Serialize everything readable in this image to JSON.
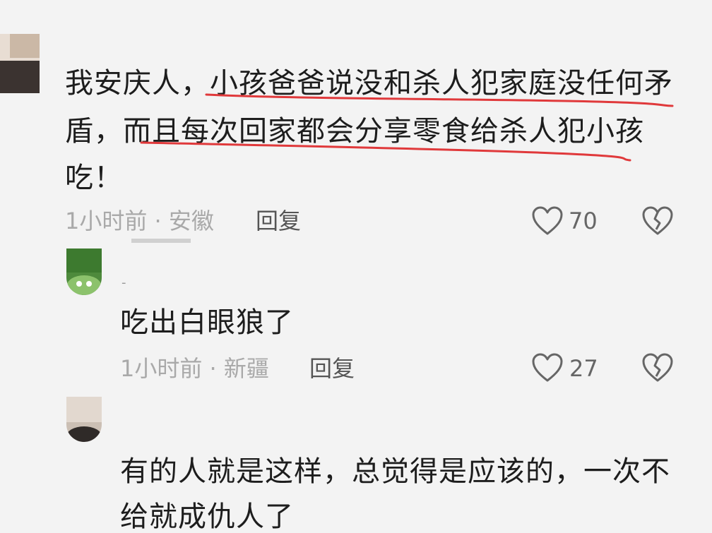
{
  "comments": [
    {
      "text_lines": [
        "我安庆人，小孩爸爸说没和杀人犯家庭没任何矛",
        "盾，而且每次回家都会分享零食给杀人犯小孩",
        "吃！"
      ],
      "meta": "1小时前 · 安徽",
      "reply_label": "回复",
      "likes": "70"
    }
  ],
  "replies": [
    {
      "username": "-",
      "text": "吃出白眼狼了",
      "meta": "1小时前 · 新疆",
      "reply_label": "回复",
      "likes": "27"
    },
    {
      "text_lines": [
        "有的人就是这样，总觉得是应该的，一次不",
        "给就成仇人了"
      ]
    }
  ],
  "colors": {
    "background": "#f3f3f3",
    "underline": "#e0393b",
    "meta": "#a9a9a9"
  },
  "icons": [
    "heart-icon",
    "broken-heart-icon"
  ]
}
